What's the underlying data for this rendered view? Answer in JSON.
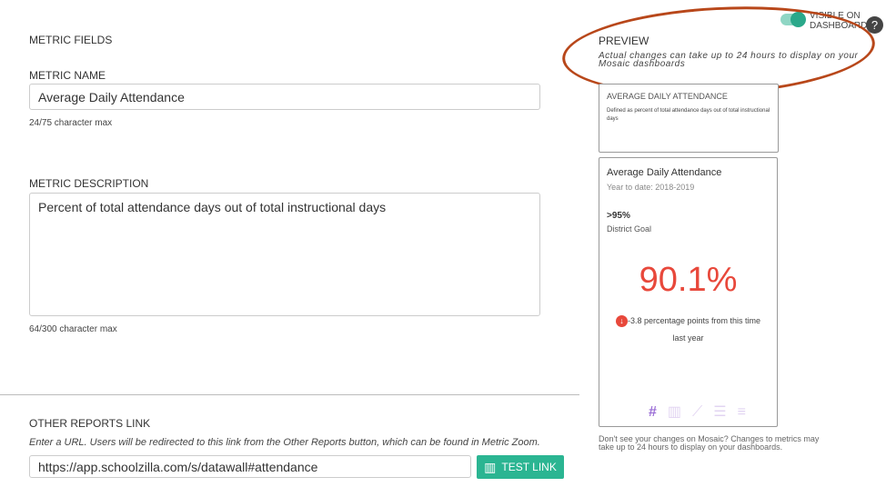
{
  "fields": {
    "section_title": "METRIC FIELDS",
    "name_label": "METRIC NAME",
    "name_value": "Average Daily Attendance",
    "name_count": "24/75 character max",
    "desc_label": "METRIC DESCRIPTION",
    "desc_value": "Percent of total attendance days out of total instructional days",
    "desc_count": "64/300 character max"
  },
  "link": {
    "label": "OTHER REPORTS LINK",
    "help": "Enter a URL. Users will be redirected to this link from the Other Reports button, which can be found in Metric Zoom.",
    "value": "https://app.schoolzilla.com/s/datawall#attendance",
    "button": "TEST LINK"
  },
  "toggle": {
    "label_line1": "VISIBLE ON",
    "label_line2": "DASHBOARD",
    "on": true,
    "color": "#2aa88a"
  },
  "preview": {
    "title": "PREVIEW",
    "note": "Actual changes can take up to 24 hours to display on your Mosaic dashboards",
    "tooltip_title": "AVERAGE DAILY ATTENDANCE",
    "tooltip_desc": "Defined as percent of total attendance days out of total instructional days",
    "card_title": "Average Daily Attendance",
    "card_period": "Year to date: 2018-2019",
    "goal_value": ">95%",
    "goal_label": "District Goal",
    "metric_value": "90.1%",
    "metric_color": "#e8483b",
    "change_text": "-3.8 percentage points from this time",
    "change_text2": "last year",
    "footer": "Don't see your changes on Mosaic? Changes to metrics may take up to 24 hours to display on your dashboards."
  },
  "viz_icons": [
    "number-icon",
    "bar-chart-icon",
    "line-chart-icon",
    "horizontal-bar-icon",
    "list-icon"
  ]
}
